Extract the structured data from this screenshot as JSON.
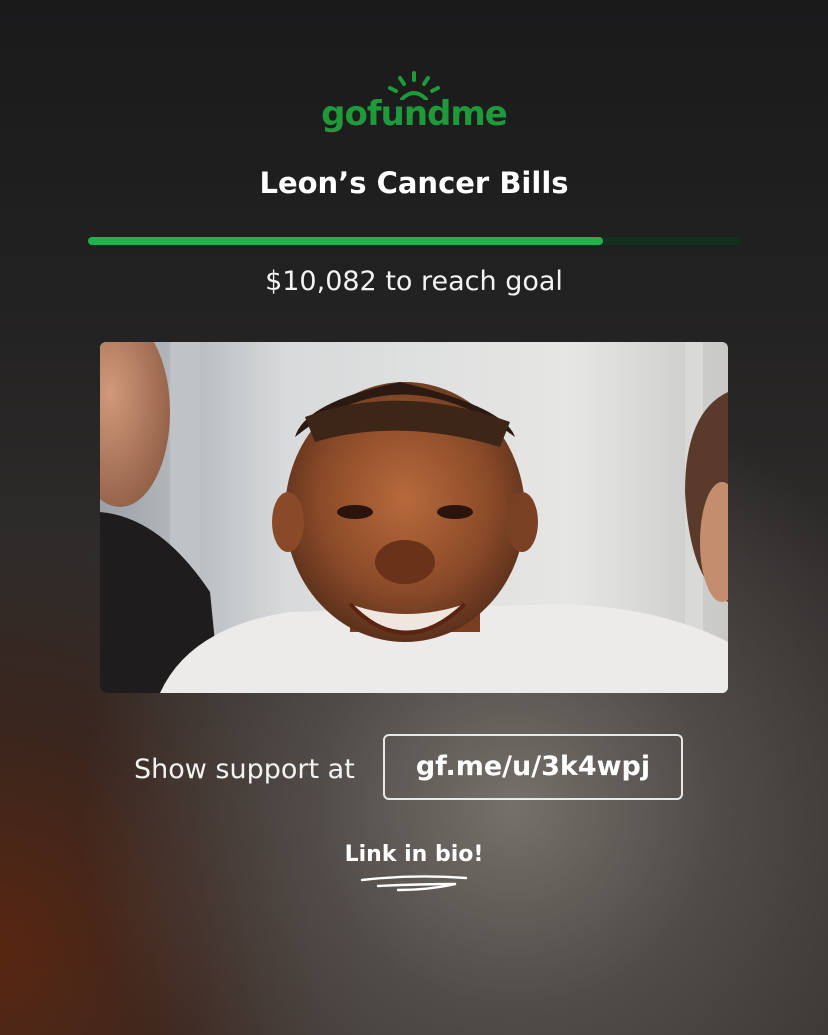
{
  "brand": {
    "name": "gofundme",
    "color": "#1f9a3a"
  },
  "campaign": {
    "title": "Leon’s Cancer Bills",
    "progress_fraction": 0.79,
    "remaining_text": "$10,082 to reach goal",
    "progress_color": "#22b14c"
  },
  "photo": {
    "icon": "campaign-photo"
  },
  "support": {
    "label": "Show support at",
    "link": "gf.me/u/3k4wpj"
  },
  "bio": {
    "text": "Link in bio!"
  }
}
